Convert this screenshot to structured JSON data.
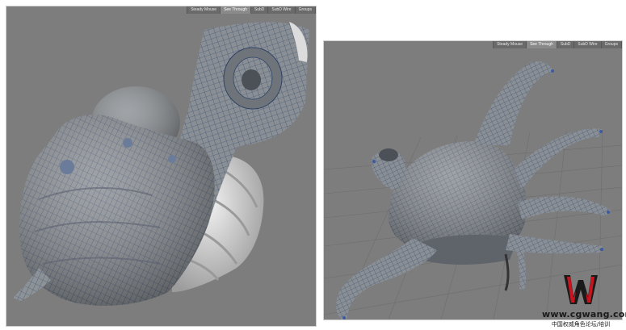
{
  "left_viewport": {
    "toolbar": [
      "Steady Mouse",
      "See Through",
      "SubD",
      "SubD Wire",
      "Groups"
    ]
  },
  "right_viewport": {
    "toolbar": [
      "Steady Mouse",
      "See Through",
      "SubD",
      "SubD Wire",
      "Groups"
    ]
  },
  "watermark": {
    "url": "www.cgwang.com",
    "subtitle": "中国权威角色论坛/培训"
  },
  "colors": {
    "viewport_bg": "#7d7d7d",
    "mesh_fill": "#8c9094",
    "mesh_wire": "#3a4f73",
    "smooth_white": "#d8d8d8",
    "logo_red": "#c8141e"
  }
}
